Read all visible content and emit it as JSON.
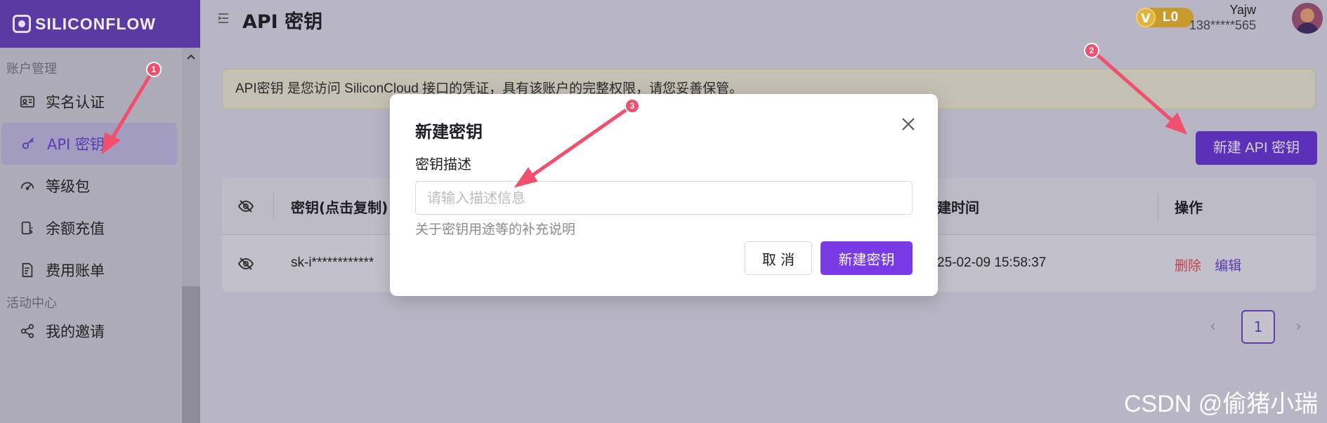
{
  "brand": {
    "name": "SILICONFLOW"
  },
  "sidebar": {
    "groups": [
      {
        "label": "账户管理"
      },
      {
        "label": "活动中心"
      }
    ],
    "items": [
      {
        "label": "实名认证",
        "icon": "id-card-icon",
        "active": false
      },
      {
        "label": "API 密钥",
        "icon": "key-icon",
        "active": true
      },
      {
        "label": "等级包",
        "icon": "gauge-icon",
        "active": false
      },
      {
        "label": "余额充值",
        "icon": "wallet-icon",
        "active": false
      },
      {
        "label": "费用账单",
        "icon": "bill-icon",
        "active": false
      },
      {
        "label": "我的邀请",
        "icon": "share-icon",
        "active": false
      }
    ]
  },
  "header": {
    "title": "API 密钥",
    "level": {
      "letter": "V",
      "label": "L0"
    },
    "user": {
      "name": "Yajw",
      "phone": "138*****565"
    }
  },
  "notice": {
    "text": "API密钥 是您访问 SiliconCloud 接口的凭证，具有该账户的完整权限，请您妥善保管。"
  },
  "toolbar": {
    "create_label": "新建 API 密钥"
  },
  "table": {
    "headers": [
      "密钥(点击复制)",
      "建时间",
      "操作"
    ],
    "rows": [
      {
        "key": "sk-i************",
        "created": "25-02-09 15:58:37",
        "actions": {
          "delete": "删除",
          "edit": "编辑"
        }
      }
    ]
  },
  "pagination": {
    "current": "1",
    "prev": "‹",
    "next": "›"
  },
  "modal": {
    "title": "新建密钥",
    "close": "×",
    "field_label": "密钥描述",
    "placeholder": "请输入描述信息",
    "value": "",
    "help": "关于密钥用途等的补充说明",
    "cancel": "取 消",
    "confirm": "新建密钥"
  },
  "annotations": {
    "badges": [
      "1",
      "2",
      "3"
    ],
    "color": "#f0506e"
  },
  "watermark": {
    "text": "CSDN @偷猪小瑞"
  },
  "colors": {
    "brand": "#5b3aa3",
    "primary": "#7a3ae6",
    "danger": "#c0404e",
    "badge": "#c99a2e"
  }
}
